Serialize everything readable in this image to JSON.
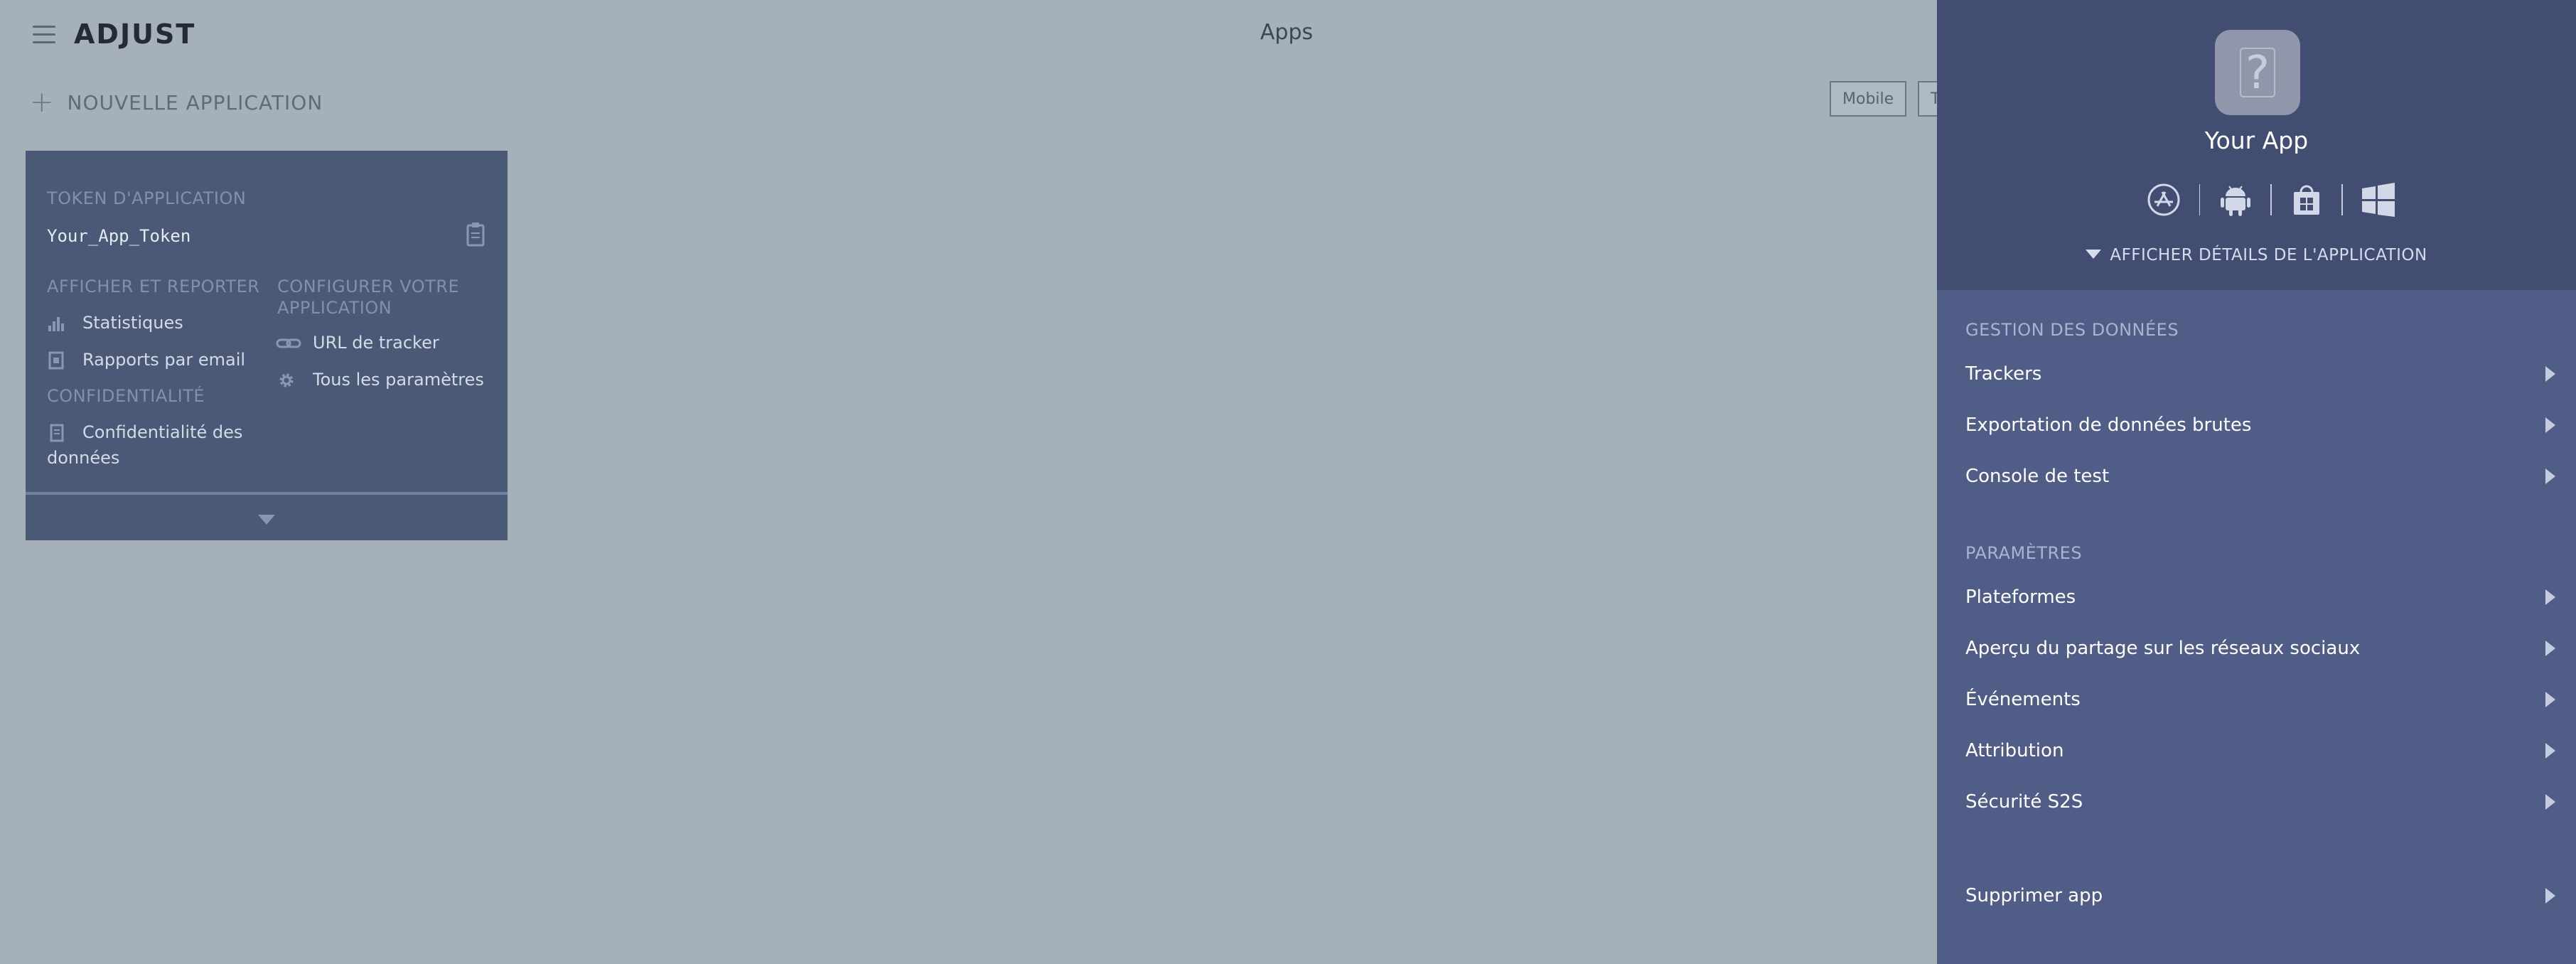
{
  "header": {
    "logo": "ADJUST",
    "title": "Apps"
  },
  "toolbar": {
    "new_app_label": "NOUVELLE APPLICATION",
    "filter_mobile": "Mobile",
    "filter_other": "T"
  },
  "app_card": {
    "token_label": "TOKEN D'APPLICATION",
    "token_value": "Your_App_Token",
    "view_section": "AFFICHER ET REPORTER",
    "statistics": "Statistiques",
    "email_reports": "Rapports par email",
    "privacy_section": "CONFIDENTIALITÉ",
    "privacy_line1": "Confidentialité des",
    "privacy_line2": "données",
    "configure_line1": "CONFIGURER VOTRE",
    "configure_line2": "APPLICATION",
    "tracker_url": "URL de tracker",
    "all_settings": "Tous les paramètres"
  },
  "drawer": {
    "app_icon_glyph": "?",
    "app_name": "Your App",
    "platforms": [
      "app-store-icon",
      "android-icon",
      "windows-store-icon",
      "windows-icon"
    ],
    "details_toggle": "AFFICHER DÉTAILS DE L'APPLICATION",
    "data_section": {
      "title": "GESTION DES DONNÉES",
      "items": [
        {
          "label": "Trackers"
        },
        {
          "label": "Exportation de données brutes"
        },
        {
          "label": "Console de test"
        }
      ]
    },
    "settings_section": {
      "title": "PARAMÈTRES",
      "items": [
        {
          "label": "Plateformes"
        },
        {
          "label": "Aperçu du partage sur les réseaux sociaux"
        },
        {
          "label": "Événements"
        },
        {
          "label": "Attribution"
        },
        {
          "label": "Sécurité S2S"
        }
      ]
    },
    "delete_label": "Supprimer app"
  },
  "colors": {
    "overlay_bg": "#a5b0b9",
    "drawer_bg": "#505d86",
    "drawer_header_bg": "#414e72",
    "card_bg": "#4a5975"
  }
}
